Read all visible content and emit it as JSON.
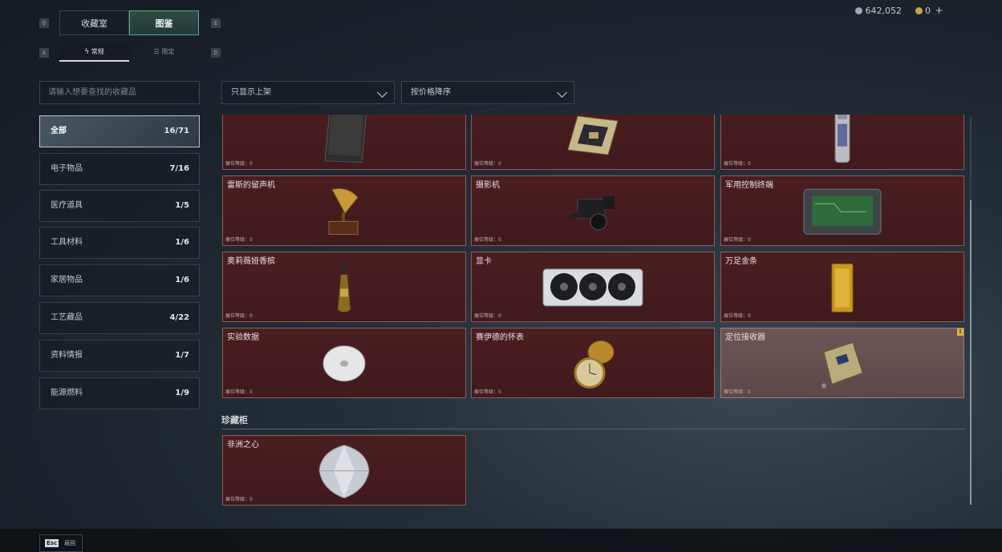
{
  "currency": {
    "coins": "642,052",
    "gold": "0",
    "plus": "+"
  },
  "key_hints": {
    "q": "Q",
    "e": "E",
    "a": "A",
    "d": "D"
  },
  "tabs": [
    {
      "label": "收藏室",
      "active": false
    },
    {
      "label": "图鉴",
      "active": true
    }
  ],
  "subtabs": [
    {
      "label": "常规",
      "icon": "lightning-icon",
      "active": true
    },
    {
      "label": "限定",
      "icon": "limited-icon",
      "active": false
    }
  ],
  "search": {
    "placeholder": "请输入想要查找的收藏品"
  },
  "categories": [
    {
      "label": "全部",
      "count": "16/71",
      "active": true
    },
    {
      "label": "电子物品",
      "count": "7/16"
    },
    {
      "label": "医疗道具",
      "count": "1/5"
    },
    {
      "label": "工具材料",
      "count": "1/6"
    },
    {
      "label": "家居物品",
      "count": "1/6"
    },
    {
      "label": "工艺藏品",
      "count": "4/22"
    },
    {
      "label": "资料情报",
      "count": "1/7"
    },
    {
      "label": "能源燃料",
      "count": "1/9"
    }
  ],
  "filters": {
    "shelf": "只显示上架",
    "sort": "按价格降序"
  },
  "items": [
    {
      "name": "",
      "rank": "展位等级：0",
      "icon": "folder-icon"
    },
    {
      "name": "",
      "rank": "展位等级：0",
      "icon": "cpu-icon"
    },
    {
      "name": "",
      "rank": "展位等级：0",
      "icon": "capsule-icon"
    },
    {
      "name": "雷斯的留声机",
      "rank": "展位等级：0",
      "icon": "gramophone-icon"
    },
    {
      "name": "摄影机",
      "rank": "展位等级：0",
      "icon": "camera-icon"
    },
    {
      "name": "军用控制终端",
      "rank": "展位等级：0",
      "icon": "terminal-icon"
    },
    {
      "name": "奥莉薇娅香槟",
      "rank": "展位等级：0",
      "icon": "champagne-icon"
    },
    {
      "name": "显卡",
      "rank": "展位等级：0",
      "icon": "gpu-icon"
    },
    {
      "name": "万足金条",
      "rank": "展位等级：0",
      "icon": "gold-bar-icon"
    },
    {
      "name": "实验数据",
      "rank": "展位等级：0",
      "icon": "disc-icon"
    },
    {
      "name": "赛伊德的怀表",
      "rank": "展位等级：0",
      "icon": "pocket-watch-icon"
    },
    {
      "name": "定位接收器",
      "rank": "展位等级：0",
      "icon": "receiver-icon",
      "badge": "!"
    }
  ],
  "section": {
    "title": "珍藏柜"
  },
  "treasure_items": [
    {
      "name": "非洲之心",
      "rank": "展位等级：0",
      "icon": "diamond-icon"
    }
  ],
  "footer": {
    "esc_key": "Esc",
    "back_label": "返回"
  }
}
